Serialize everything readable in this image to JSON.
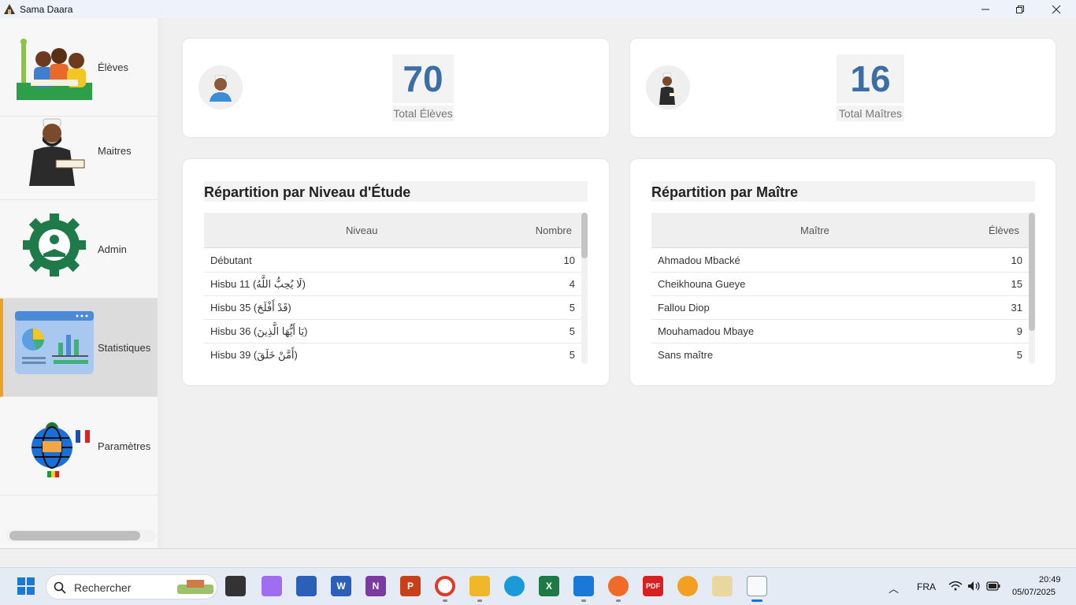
{
  "window": {
    "title": "Sama Daara",
    "minimize_icon": "minimize-icon",
    "maximize_icon": "restore-icon",
    "close_icon": "close-icon"
  },
  "sidebar": {
    "items": [
      {
        "label": "Élèves",
        "icon": "students-illustration-icon",
        "active": false
      },
      {
        "label": "Maitres",
        "icon": "teacher-illustration-icon",
        "active": false
      },
      {
        "label": "Admin",
        "icon": "admin-gear-icon",
        "active": false
      },
      {
        "label": "Statistiques",
        "icon": "statistics-chart-icon",
        "active": true
      },
      {
        "label": "Paramètres",
        "icon": "globe-flags-icon",
        "active": false
      }
    ]
  },
  "stats": {
    "students": {
      "value": "70",
      "caption": "Total Élèves"
    },
    "teachers": {
      "value": "16",
      "caption": "Total Maîtres"
    }
  },
  "level_table": {
    "title": "Répartition par Niveau d'Étude",
    "headers": [
      "Niveau",
      "Nombre"
    ],
    "rows": [
      {
        "name": "Débutant",
        "count": "10"
      },
      {
        "name": "Hisbu 11 (لَا يُحِبُّ اللَّهُ)",
        "count": "4"
      },
      {
        "name": "Hisbu 35 (قَدْ أَفْلَحَ)",
        "count": "5"
      },
      {
        "name": "Hisbu 36 (يَا أَيُّهَا الَّذِينَ)",
        "count": "5"
      },
      {
        "name": "Hisbu 39 (أَمَّنْ خَلَقَ)",
        "count": "5"
      }
    ]
  },
  "teacher_table": {
    "title": "Répartition par Maître",
    "headers": [
      "Maître",
      "Élèves"
    ],
    "rows": [
      {
        "name": "Ahmadou Mbacké",
        "count": "10"
      },
      {
        "name": "Cheikhouna Gueye",
        "count": "15"
      },
      {
        "name": "Fallou Diop",
        "count": "31"
      },
      {
        "name": "Mouhamadou Mbaye",
        "count": "9"
      },
      {
        "name": "Sans maître",
        "count": "5"
      }
    ]
  },
  "taskbar": {
    "search_placeholder": "Rechercher",
    "language": "FRA",
    "time": "20:49",
    "date": "05/07/2025"
  },
  "colors": {
    "accent": "#3b6ea5",
    "active_marker": "#f0a020"
  }
}
